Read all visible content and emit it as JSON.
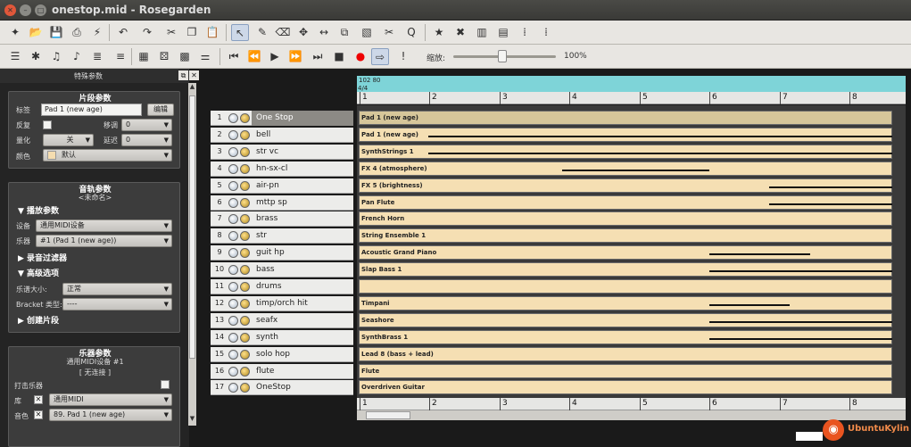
{
  "window": {
    "title": "onestop.mid - Rosegarden"
  },
  "zoom": {
    "label": "缩放:",
    "value": "100%"
  },
  "panel": {
    "title": "特殊参数",
    "segment_params": {
      "heading": "片段参数",
      "label_caption": "标签",
      "label_value": "Pad 1 (new age)",
      "edit_button": "编辑",
      "repeat_caption": "反复",
      "transpose_caption": "移调",
      "transpose_value": "0",
      "quantize_caption": "量化",
      "quantize_value": "关",
      "delay_caption": "延迟",
      "delay_value": "0",
      "color_caption": "颜色",
      "color_value": "默认"
    },
    "track_params": {
      "heading": "音轨参数",
      "subheading": "<未命名>",
      "playback_expander": "▼ 播放参数",
      "device_caption": "设备",
      "device_value": "通用MIDI设备",
      "instrument_caption": "乐器",
      "instrument_value": "#1 (Pad 1 (new age))",
      "record_filter_expander": "▶ 录音过滤器",
      "advanced_expander": "▼ 高级选项",
      "staff_size_caption": "乐谱大小:",
      "staff_size_value": "正常",
      "bracket_caption": "Bracket 类型:",
      "bracket_value": "----",
      "create_segment_expander": "▶ 创建片段"
    },
    "instrument_params": {
      "heading": "乐器参数",
      "subheading": "通用MIDI设备 #1",
      "connection": "[ 无连接 ]",
      "percussion_caption": "打击乐器",
      "bank_caption": "库",
      "bank_value": "通用MIDI",
      "program_caption": "音色",
      "program_value": "89. Pad 1 (new age)"
    }
  },
  "tempo": {
    "text": "102  80"
  },
  "time_signature": "4/4",
  "ruler": {
    "bars": [
      "1",
      "2",
      "3",
      "4",
      "5",
      "6",
      "7",
      "8"
    ]
  },
  "tracks": [
    {
      "num": "1",
      "name": "One Stop",
      "segment": "Pad 1 (new age)",
      "selected": true
    },
    {
      "num": "2",
      "name": "bell",
      "segment": "Pad 1 (new age)"
    },
    {
      "num": "3",
      "name": "str vc",
      "segment": "SynthStrings 1"
    },
    {
      "num": "4",
      "name": "hn-sx-cl",
      "segment": "FX 4 (atmosphere)"
    },
    {
      "num": "5",
      "name": "air-pn",
      "segment": "FX 5 (brightness)"
    },
    {
      "num": "6",
      "name": "mttp sp",
      "segment": "Pan Flute"
    },
    {
      "num": "7",
      "name": "brass",
      "segment": "French Horn"
    },
    {
      "num": "8",
      "name": "str",
      "segment": "String Ensemble 1"
    },
    {
      "num": "9",
      "name": "guit hp",
      "segment": "Acoustic Grand Piano"
    },
    {
      "num": "10",
      "name": "bass",
      "segment": "Slap Bass 1"
    },
    {
      "num": "11",
      "name": "drums",
      "segment": ""
    },
    {
      "num": "12",
      "name": "timp/orch hit",
      "segment": "Timpani"
    },
    {
      "num": "13",
      "name": "seafx",
      "segment": "Seashore"
    },
    {
      "num": "14",
      "name": "synth",
      "segment": "SynthBrass 1"
    },
    {
      "num": "15",
      "name": "solo hop",
      "segment": "Lead 8 (bass + lead)"
    },
    {
      "num": "16",
      "name": "flute",
      "segment": "Flute"
    },
    {
      "num": "17",
      "name": "OneStop",
      "segment": "Overdriven Guitar"
    }
  ],
  "watermark": "UbuntuKylin"
}
